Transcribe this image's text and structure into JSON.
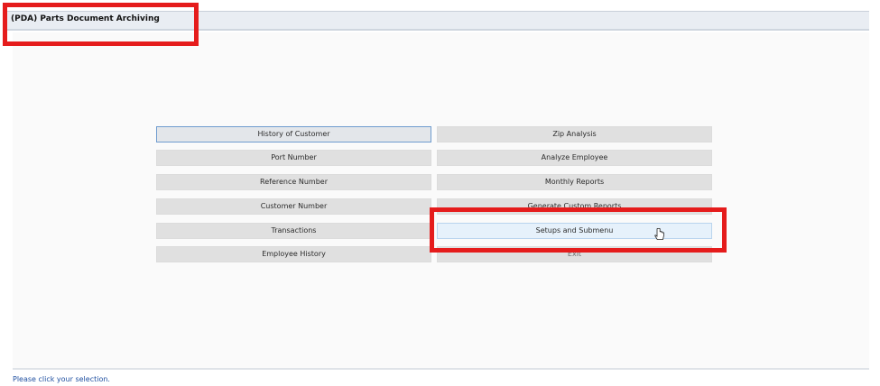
{
  "window": {
    "title": "(PDA) Parts Document Archiving"
  },
  "menu": {
    "left": [
      "History of Customer",
      "Port Number",
      "Reference Number",
      "Customer Number",
      "Transactions",
      "Employee History"
    ],
    "right": [
      "Zip Analysis",
      "Analyze Employee",
      "Monthly Reports",
      "Generate Custom Reports",
      "Setups and Submenu",
      "Exit"
    ]
  },
  "status": {
    "text": "Please click your selection."
  },
  "icons": {
    "cursor": "hand-pointer-icon"
  },
  "colors": {
    "annotation_red": "#e51c1c",
    "status_blue": "#1f4fa0",
    "focus_border": "#6f9ccf"
  }
}
